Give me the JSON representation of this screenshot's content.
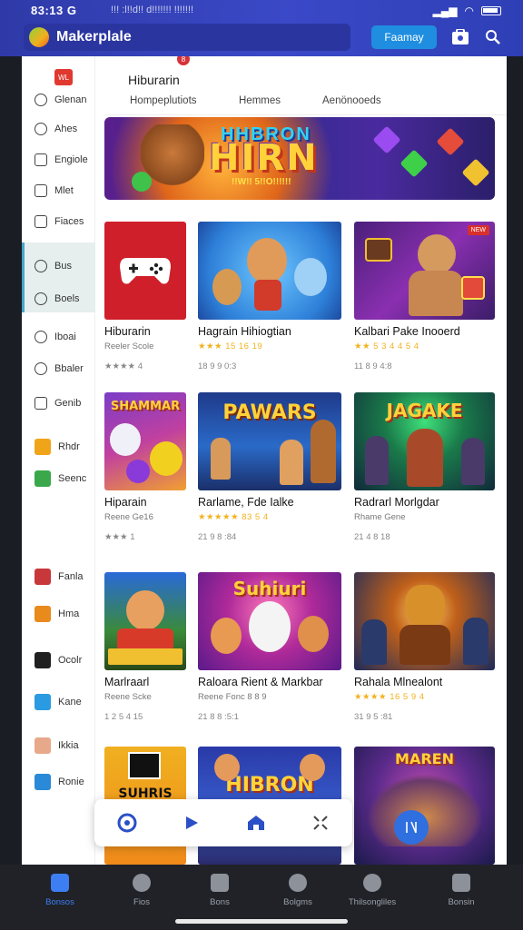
{
  "status_bar": {
    "time": "83:13",
    "time_suffix": "G",
    "notice": "!!! :l!!d!! d!!!!!!! !!!!!!!"
  },
  "header": {
    "app_name": "Makerplale",
    "primary_button": "Faamay",
    "icons": [
      "cart-icon",
      "search-icon"
    ]
  },
  "sidebar": {
    "home_chip": "WL",
    "items": [
      {
        "label": "Glenan",
        "icon": "search-icon"
      },
      {
        "label": "Ahes",
        "icon": "chat-icon"
      },
      {
        "label": "Engiole",
        "icon": "document-icon"
      },
      {
        "label": "Mlet",
        "icon": "check-icon"
      },
      {
        "label": "Fiaces",
        "icon": "image-icon"
      },
      {
        "label": "Bus",
        "icon": "search-icon"
      },
      {
        "label": "Boels",
        "icon": "person-icon"
      },
      {
        "label": "Iboai",
        "icon": "gamepad-icon"
      },
      {
        "label": "Bbaler",
        "icon": "clock-icon"
      },
      {
        "label": "Genib",
        "icon": "message-icon"
      },
      {
        "label": "Rhdr",
        "icon": "game-icon"
      },
      {
        "label": "Seenc",
        "icon": "game-icon"
      },
      {
        "label": "Fanla",
        "icon": "game-icon"
      },
      {
        "label": "Hma",
        "icon": "game-icon"
      },
      {
        "label": "Ocolr",
        "icon": "game-icon"
      },
      {
        "label": "Kane",
        "icon": "game-icon"
      },
      {
        "label": "Ikkia",
        "icon": "game-icon"
      },
      {
        "label": "Ronie",
        "icon": "game-icon"
      }
    ]
  },
  "main": {
    "title": "Hiburarin",
    "title_badge": "8",
    "tabs": [
      "Hompeplutiots",
      "Hemmes",
      "Aenönooeds"
    ],
    "banner": {
      "top": "HHBRON",
      "title": "HIRN",
      "sub": "!!W!! 5!!O!!!!!!"
    },
    "cards": [
      {
        "title": "Hiburarin",
        "meta": "Reeler Scole",
        "sub": "★★★★ 4",
        "badge": ""
      },
      {
        "title": "Hagrain Hihiogtian",
        "meta": "★★★ 15 16 19",
        "sub": "18 9 9 0:3",
        "badge": ""
      },
      {
        "title": "Kalbari Pake Inooerd",
        "meta": "★★ 5 3 4 4 5 4",
        "sub": "11 8 9 4:8",
        "badge": "NEW"
      },
      {
        "title": "Hiparain",
        "meta": "Reene Ge16",
        "sub": "★★★ 1",
        "badge": ""
      },
      {
        "title": "Rarlame, Fde Ialke",
        "meta": "★★★★★ 83 5 4",
        "sub": "21 9 8 :84",
        "badge": ""
      },
      {
        "title": "Radrarl Morlgdar",
        "meta": "Rhame Gene",
        "sub": "21 4 8 18",
        "badge": ""
      },
      {
        "title": "Marlraarl",
        "meta": "Reene Scke",
        "sub": "1 2 5 4 15",
        "badge": ""
      },
      {
        "title": "Raloara Rient & Markbar",
        "meta": "Reene Fonc 8 8 9",
        "sub": "21 8 8 :5:1",
        "badge": ""
      },
      {
        "title": "Rahala Mlnealont",
        "meta": "★★★★ 16 5 9 4",
        "sub": "31 9 5 :81",
        "badge": ""
      }
    ],
    "thumb_texts": [
      "",
      "",
      "",
      "SHAMMAR",
      "PAWARS",
      "JAGAKE",
      "",
      "Suhiuri",
      "",
      "SUHRIS",
      "HIBRON",
      "MAREN"
    ]
  },
  "fab_bar": {
    "icons": [
      "gamepad-icon",
      "play-icon",
      "home-icon",
      "crop-icon"
    ]
  },
  "bottom_nav": {
    "items": [
      {
        "label": "Bonsos",
        "icon": "home-icon",
        "active": true
      },
      {
        "label": "Fios",
        "icon": "record-icon",
        "active": false
      },
      {
        "label": "Bons",
        "icon": "inbox-icon",
        "active": false
      },
      {
        "label": "Bolgms",
        "icon": "globe-icon",
        "active": false
      },
      {
        "label": "Thilsongliles",
        "icon": "people-icon",
        "active": false
      },
      {
        "label": "Bonsin",
        "icon": "account-icon",
        "active": false
      }
    ]
  },
  "colors": {
    "header": "#3a49c7",
    "accent": "#1f8ee0",
    "nav_active": "#3d7ff2",
    "star": "#f2b21e"
  }
}
